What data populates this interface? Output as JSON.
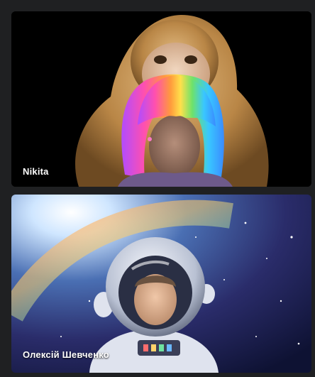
{
  "participants": [
    {
      "name": "Nikita",
      "video_effect": "monkey-and-rainbow-wig"
    },
    {
      "name": "Олексій Шевченко",
      "video_effect": "astronaut-in-space"
    }
  ],
  "colors": {
    "app_background": "#1f2022",
    "tile_background": "#000000",
    "label_text": "#ffffff"
  }
}
